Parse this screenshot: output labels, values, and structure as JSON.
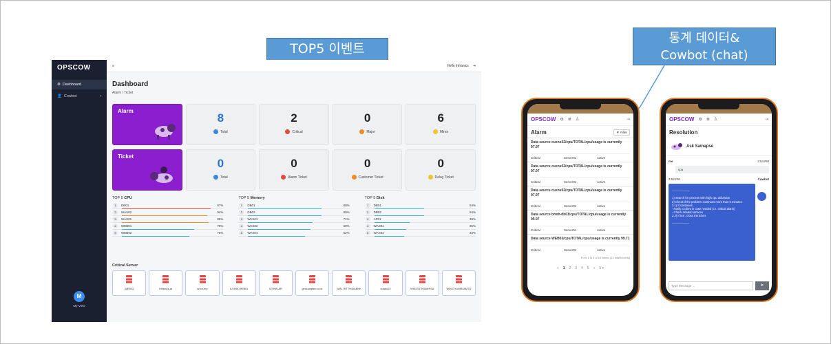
{
  "callouts": {
    "top5": "TOP5 이벤트",
    "stats_line1": "통계 데이터&",
    "stats_line2": "Cowbot (chat)"
  },
  "sidebar": {
    "logo": "OPSCOW",
    "items": [
      {
        "label": "Dashboard"
      },
      {
        "label": "Cowbot"
      }
    ],
    "bottom_label": "My-View"
  },
  "topbar": {
    "menu_icon": "≡",
    "greeting": "Hello Infranics"
  },
  "dashboard": {
    "title": "Dashboard",
    "subtitle": "Alarm / Ticket",
    "alarm": {
      "label": "Alarm",
      "tiles": [
        {
          "value": "8",
          "label": "Total",
          "color": "#3a86e0"
        },
        {
          "value": "2",
          "label": "Critical",
          "color": "#e24a3b"
        },
        {
          "value": "0",
          "label": "Major",
          "color": "#f08a24"
        },
        {
          "value": "6",
          "label": "Minor",
          "color": "#f2c230"
        }
      ]
    },
    "ticket": {
      "label": "Ticket",
      "tiles": [
        {
          "value": "0",
          "label": "Total",
          "color": "#3a86e0"
        },
        {
          "value": "0",
          "label": "Alarm Ticket",
          "color": "#e24a3b"
        },
        {
          "value": "0",
          "label": "Customer Ticket",
          "color": "#f08a24"
        },
        {
          "value": "0",
          "label": "Delay Ticket",
          "color": "#f2c230"
        }
      ]
    }
  },
  "top5": [
    {
      "title_pre": "TOP 5 ",
      "title_bold": "CPU",
      "rows": [
        {
          "n": "1",
          "name": "DB01",
          "pct": "97%"
        },
        {
          "n": "2",
          "name": "WAS02",
          "pct": "94%"
        },
        {
          "n": "3",
          "name": "WAS01",
          "pct": "95%"
        },
        {
          "n": "4",
          "name": "WEB01",
          "pct": "79%"
        },
        {
          "n": "5",
          "name": "WEB02",
          "pct": "75%"
        }
      ]
    },
    {
      "title_pre": "TOP 5 ",
      "title_bold": "Memory",
      "rows": [
        {
          "n": "1",
          "name": "DB01",
          "pct": "80%"
        },
        {
          "n": "2",
          "name": "DB02",
          "pct": "80%"
        },
        {
          "n": "3",
          "name": "WAS01",
          "pct": "71%"
        },
        {
          "n": "4",
          "name": "WAS02",
          "pct": "68%"
        },
        {
          "n": "5",
          "name": "WAS04",
          "pct": "62%"
        }
      ]
    },
    {
      "title_pre": "TOP 5 ",
      "title_bold": "Disk",
      "rows": [
        {
          "n": "1",
          "name": "DB01",
          "pct": "54%"
        },
        {
          "n": "2",
          "name": "DB02",
          "pct": "54%"
        },
        {
          "n": "3",
          "name": "AP01",
          "pct": "38%"
        },
        {
          "n": "4",
          "name": "WAS01",
          "pct": "35%"
        },
        {
          "n": "5",
          "name": "WAS02",
          "pct": "33%"
        }
      ]
    }
  ],
  "critical": {
    "title": "Critical Server",
    "servers": [
      "WEB03",
      "Infranics-ar",
      "arion-erp",
      "ILSHIN-WEB01",
      "ILSHIN-AR",
      "geusungtam.co.kr",
      "WIN-7RTTH40ABNK",
      "cuasoD3",
      "WIN-EQ7KSBKRSA",
      "WIN-GYUMR4AMTG"
    ]
  },
  "phone1": {
    "logo": "OPSCOW",
    "title": "Alarm",
    "filter": "Filter",
    "alarms": [
      {
        "text": "Data source cuens02/cpu/TOTAL/cpu/usage is currently 97.97",
        "level": "Critical",
        "server": "Server01",
        "state": "Active"
      },
      {
        "text": "Data source cuens02/cpu/TOTAL/cpu/usage is currently 97.97",
        "level": "Critical",
        "server": "Server01",
        "state": "Active"
      },
      {
        "text": "Data source cuens02/cpu/TOTAL/cpu/usage is currently 97.97",
        "level": "Critical",
        "server": "Server01",
        "state": "Active"
      },
      {
        "text": "Data source brmh-db01/cpu/TOTAL/cpu/usage is currently 95.97",
        "level": "Critical",
        "server": "Server01",
        "state": "Active"
      },
      {
        "text": "Data source WEB03/cpu/TOTAL/cpu/usage is currently 99.71",
        "level": "Critical",
        "server": "Server01",
        "state": "Active"
      }
    ],
    "page_info": "From 1 to 5 of 16 entries (10 total records)",
    "pager": [
      "«",
      "1",
      "2",
      "3",
      "4",
      "5",
      "»",
      "5 ▾"
    ]
  },
  "phone2": {
    "logo": "OPSCOW",
    "title": "Resolution",
    "bot": "Ask Sainapse",
    "me": "me",
    "me_time": "3:53 PM",
    "me_msg": "cpu",
    "bot_time": "3:53 PM",
    "bot_name": "Cowbot",
    "bubble": [
      "------------------",
      "",
      "1) Search for process with high cpu utilization",
      "2) Check if the problem continues more than 5 minutes",
      "2.1) If continues",
      "- Notify a client in case needed (i.e. critical alarm)",
      "- Check related services",
      "2.2) If not : close the ticket",
      "",
      "------------------"
    ],
    "input_placeholder": "Type Message ..."
  }
}
